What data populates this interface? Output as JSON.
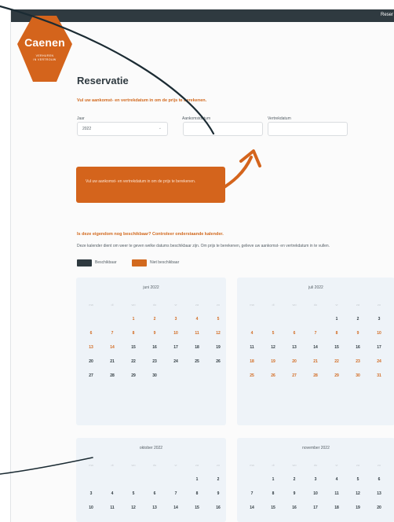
{
  "topbar": {
    "link": "Reser"
  },
  "logo": {
    "name": "Caenen",
    "sub1": "VERHUREN",
    "sub2": "IN VERTROUW"
  },
  "form": {
    "title": "Reservatie",
    "instruction": "Vul uw aankomst- en vertrekdatum in om de prijs te berekenen.",
    "year_label": "Jaar",
    "year_value": "2022",
    "arrival_label": "Aankomstdatum",
    "departure_label": "Vertrekdatum"
  },
  "cta": {
    "text": "Vul uw aankomst- en vertrekdatum in om de prijs te berekenen."
  },
  "availability": {
    "title": "Is deze eigendom nog beschikbaar? Controleer onderstaande kalender.",
    "description": "Deze kalender dient om weer te geven welke datums beschikbaar zijn. Om prijs te berekenen, gelieve uw aankomst- en vertrekdatum in te vullen.",
    "legend_available": "Beschikbaar",
    "legend_unavailable": "Niet beschikbaar"
  },
  "colors": {
    "brand": "#d4641c",
    "dark": "#2f3a40",
    "card": "#eef3f8"
  },
  "weekdays": [
    "ma",
    "di",
    "wo",
    "do",
    "vr",
    "za",
    "zo"
  ],
  "calendars": [
    {
      "title": "juni 2022",
      "offset": 2,
      "unavailable": [
        1,
        2,
        3,
        4,
        5,
        6,
        7,
        8,
        9,
        10,
        11,
        12,
        13,
        14
      ]
    },
    {
      "title": "juli 2022",
      "offset": 4,
      "unavailable": [
        4,
        5,
        6,
        7,
        8,
        9,
        10,
        18,
        19,
        20,
        21,
        22,
        23,
        24,
        25,
        26,
        27,
        28,
        29,
        30,
        31
      ]
    },
    {
      "title": "oktober 2022",
      "offset": 5,
      "unavailable": []
    },
    {
      "title": "november 2022",
      "offset": 1,
      "unavailable": []
    }
  ]
}
